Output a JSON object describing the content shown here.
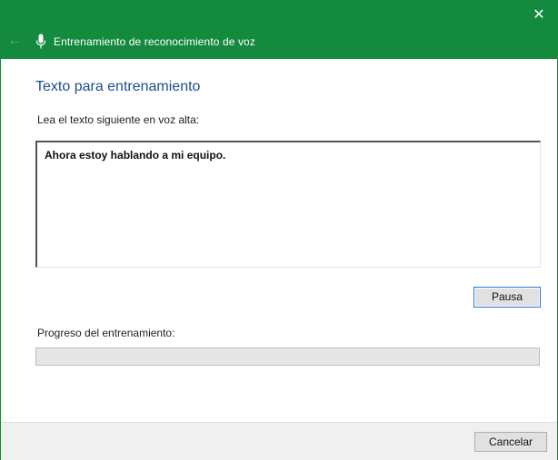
{
  "window": {
    "title": "Entrenamiento de reconocimiento de voz",
    "accent_color": "#138a3e"
  },
  "titlebar": {
    "back_icon": "←",
    "close_icon": "✕"
  },
  "main": {
    "heading": "Texto para entrenamiento",
    "instruction": "Lea el texto siguiente en voz alta:",
    "training_text": "Ahora estoy hablando a mi equipo.",
    "pause_label": "Pausa",
    "progress_label": "Progreso del entrenamiento:",
    "progress_value": 0
  },
  "footer": {
    "cancel_label": "Cancelar"
  }
}
